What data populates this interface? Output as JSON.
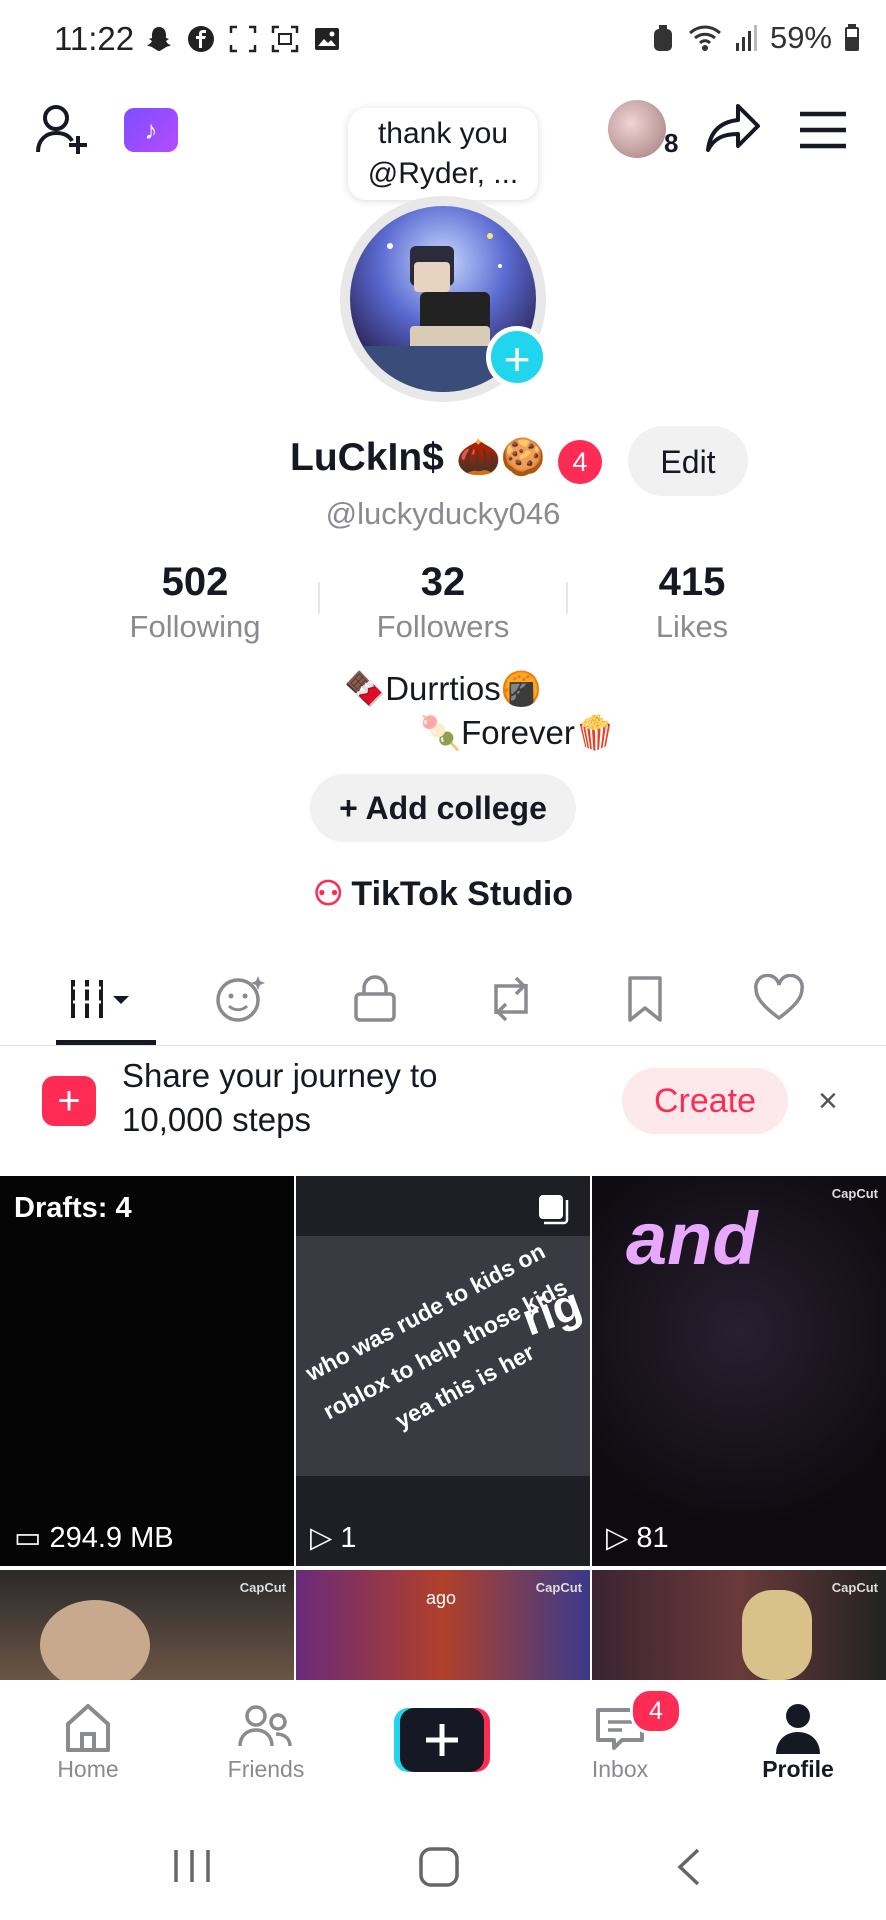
{
  "status_bar": {
    "time": "11:22",
    "battery": "59%"
  },
  "header": {
    "speech_bubble": "thank you @Ryder, ...",
    "group_count": "8"
  },
  "profile": {
    "display_name": "LuCkIn$",
    "name_emoji": "🌰🍪",
    "notification_badge": "4",
    "edit_label": "Edit",
    "username": "@luckyducky046",
    "stats": [
      {
        "value": "502",
        "label": "Following"
      },
      {
        "value": "32",
        "label": "Followers"
      },
      {
        "value": "415",
        "label": "Likes"
      }
    ],
    "bio_line1": "🍫Durrtios🍘",
    "bio_line2": "🍡Forever🍿",
    "add_college": "+ Add college",
    "studio": "TikTok Studio"
  },
  "banner": {
    "text": "Share your journey to 10,000 steps",
    "create_label": "Create",
    "close": "×"
  },
  "grid": {
    "drafts_label": "Drafts: 4",
    "drafts_size": "294.9 MB",
    "video2_text": "who was rude to kids on roblox to help those kids yea this is her",
    "video2_big": "rig",
    "video2_views": "1",
    "video3_text": "and",
    "video3_views": "81",
    "capcut": "CapCut",
    "video5_text": "ago"
  },
  "bottom_nav": {
    "home": "Home",
    "friends": "Friends",
    "inbox": "Inbox",
    "inbox_badge": "4",
    "profile": "Profile"
  },
  "colors": {
    "accent": "#fe2c55",
    "teal": "#20d5ec",
    "text": "#161823",
    "muted": "#8a8b91"
  }
}
